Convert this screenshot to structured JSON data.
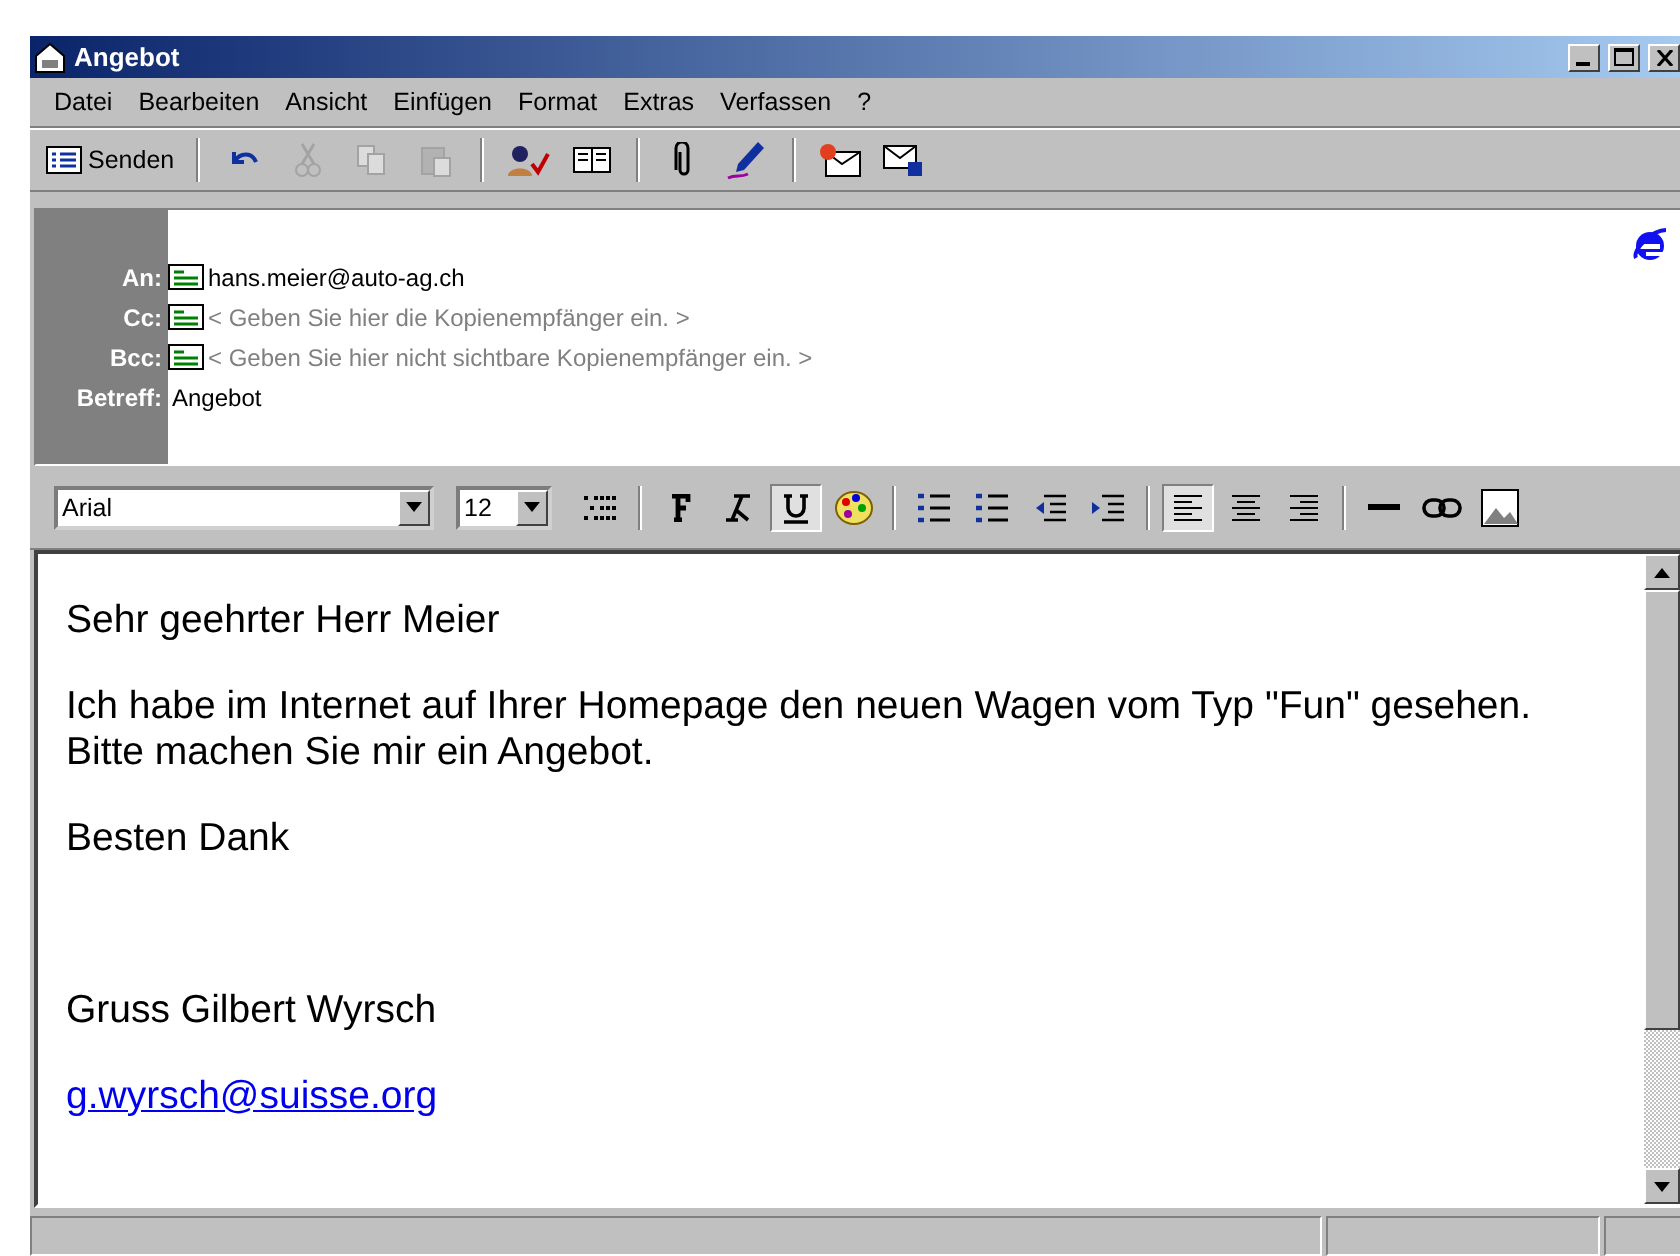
{
  "window": {
    "title": "Angebot"
  },
  "menu": [
    "Datei",
    "Bearbeiten",
    "Ansicht",
    "Einfügen",
    "Format",
    "Extras",
    "Verfassen",
    "?"
  ],
  "toolbar": {
    "send_label": "Senden",
    "tools": [
      {
        "kind": "undo",
        "disabled": false
      },
      {
        "kind": "cut",
        "disabled": true
      },
      {
        "kind": "copy",
        "disabled": true
      },
      {
        "kind": "paste",
        "disabled": true
      },
      {
        "kind": "sep"
      },
      {
        "kind": "check",
        "disabled": false
      },
      {
        "kind": "book",
        "disabled": false
      },
      {
        "kind": "sep"
      },
      {
        "kind": "clip",
        "disabled": false
      },
      {
        "kind": "pen",
        "disabled": false
      },
      {
        "kind": "sep"
      },
      {
        "kind": "sign",
        "disabled": false
      },
      {
        "kind": "lock",
        "disabled": false
      }
    ]
  },
  "header": {
    "fields": [
      {
        "label": "An:",
        "value": "hans.meier@auto-ag.ch",
        "card": true
      },
      {
        "label": "Cc:",
        "placeholder": "< Geben Sie hier die Kopienempfänger ein. >",
        "card": true
      },
      {
        "label": "Bcc:",
        "placeholder": "< Geben Sie hier nicht sichtbare Kopienempfänger ein. >",
        "card": true
      },
      {
        "label": "Betreff:",
        "value": "Angebot",
        "card": false
      }
    ]
  },
  "format_toolbar": {
    "font": "Arial",
    "size": "12",
    "buttons": [
      {
        "kind": "style",
        "pressed": false
      },
      {
        "kind": "sep"
      },
      {
        "kind": "bold",
        "pressed": false
      },
      {
        "kind": "italic",
        "pressed": false
      },
      {
        "kind": "underline",
        "pressed": true
      },
      {
        "kind": "color",
        "pressed": false
      },
      {
        "kind": "sep"
      },
      {
        "kind": "numbered",
        "pressed": false
      },
      {
        "kind": "bullets",
        "pressed": false
      },
      {
        "kind": "outdent",
        "pressed": false
      },
      {
        "kind": "indent",
        "pressed": false
      },
      {
        "kind": "sep"
      },
      {
        "kind": "align-left",
        "pressed": true
      },
      {
        "kind": "align-center",
        "pressed": false
      },
      {
        "kind": "align-right",
        "pressed": false
      },
      {
        "kind": "sep"
      },
      {
        "kind": "rule",
        "pressed": false
      },
      {
        "kind": "link",
        "pressed": false
      },
      {
        "kind": "image",
        "pressed": false
      }
    ]
  },
  "body": {
    "paragraphs": [
      {
        "kind": "text",
        "lines": [
          "Sehr geehrter Herr Meier"
        ]
      },
      {
        "kind": "text",
        "lines": [
          "Ich habe im Internet auf Ihrer Homepage den neuen Wagen vom Typ \"Fun\" gesehen.",
          "Bitte machen Sie mir ein Angebot."
        ]
      },
      {
        "kind": "text",
        "lines": [
          "Besten Dank"
        ]
      },
      {
        "kind": "blank"
      },
      {
        "kind": "text",
        "lines": [
          "Gruss Gilbert Wyrsch"
        ]
      },
      {
        "kind": "link",
        "lines": [
          "g.wyrsch@suisse.org"
        ]
      }
    ]
  }
}
